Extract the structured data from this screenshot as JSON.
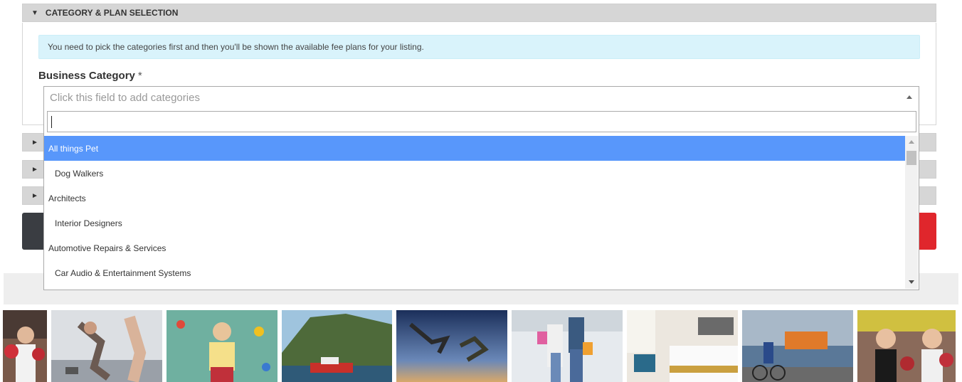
{
  "section": {
    "toggle_icon": "triangle-down-icon",
    "title": "CATEGORY & PLAN SELECTION",
    "info_message": "You need to pick the categories first and then you'll be shown the available fee plans for your listing."
  },
  "business_category": {
    "label": "Business Category",
    "required_mark": "*",
    "placeholder": "Click this field to add categories",
    "search_value": ""
  },
  "collapsed_sections": [
    {
      "icon": "triangle-right-icon",
      "glyph": "►"
    },
    {
      "icon": "triangle-right-icon",
      "glyph": "►"
    },
    {
      "icon": "triangle-right-icon",
      "glyph": "►"
    }
  ],
  "dropdown_options": [
    {
      "label": "All things Pet",
      "level": 0,
      "selected": true
    },
    {
      "label": "Dog Walkers",
      "level": 1,
      "selected": false
    },
    {
      "label": "Architects",
      "level": 0,
      "selected": false
    },
    {
      "label": "Interior Designers",
      "level": 1,
      "selected": false
    },
    {
      "label": "Automotive Repairs & Services",
      "level": 0,
      "selected": false
    },
    {
      "label": "Car Audio & Entertainment Systems",
      "level": 1,
      "selected": false
    }
  ],
  "colors": {
    "section_header_bg": "#d6d6d6",
    "info_bg": "#d9f3fb",
    "selected_option_bg": "#5897fb",
    "dark_button": "#3a3d42",
    "red_button": "#e0262c"
  },
  "photo_strip": [
    "boxing-girl-photo",
    "gym-workout-photo",
    "climbing-wall-photo",
    "coastal-boat-photo",
    "skydivers-photo",
    "shopping-couple-photo",
    "hotel-room-photo",
    "cyclists-harbour-photo",
    "boxing-kids-photo"
  ]
}
